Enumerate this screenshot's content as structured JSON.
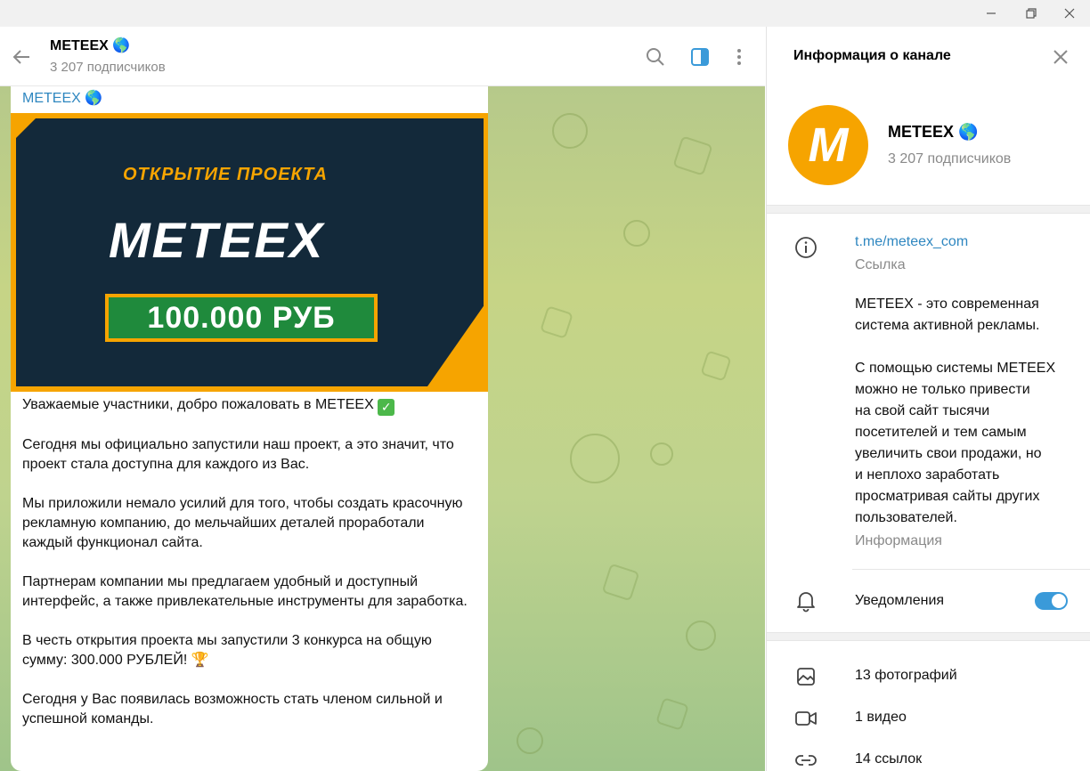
{
  "window": {
    "controls": [
      "minimize-icon",
      "restore-icon",
      "close-icon"
    ]
  },
  "chat": {
    "title": "METEEX 🌎",
    "subtitle": "3 207 подписчиков",
    "header_icons": [
      "search-icon",
      "sidebar-toggle-icon",
      "more-vertical-icon"
    ]
  },
  "message": {
    "author": "METEEX 🌎",
    "banner": {
      "kicker": "ОТКРЫТИЕ ПРОЕКТА",
      "title": "METEEX",
      "prize": "100.000 РУБ"
    },
    "paragraphs": [
      "Уважаемые участники, добро пожаловать в METEEX",
      "Сегодня мы официально запустили наш проект, а это значит, что проект стала доступна для каждого из Вас.",
      "Мы приложили немало усилий для того, чтобы создать красочную рекламную компанию, до мельчайших деталей проработали каждый функционал сайта.",
      "Партнерам компании мы предлагаем удобный и доступный интерфейс, а также привлекательные инструменты для заработка.",
      "В честь открытия проекта мы запустили 3 конкурса на общую сумму: 300.000 РУБЛЕЙ! 🏆",
      "Сегодня у Вас появилась возможность стать членом сильной и успешной команды."
    ],
    "check_emoji": "✓"
  },
  "info_panel": {
    "header_title": "Информация о канале",
    "avatar_letter": "M",
    "name": "METEEX 🌎",
    "subscribers": "3 207 подписчиков",
    "link": "t.me/meteex_com",
    "link_label": "Ссылка",
    "description": "METEEX - это современная\nсистема активной рекламы.\n\nС помощью системы METEEX\nможно не только привести\nна свой сайт тысячи\nпосетителей и тем самым\nувеличить свои продажи, но\nи неплохо заработать\nпросматривая сайты других\nпользователей.",
    "description_label": "Информация",
    "notifications_label": "Уведомления",
    "notifications_on": true,
    "media": [
      {
        "label": "13 фотографий",
        "icon": "photo-icon"
      },
      {
        "label": "1 видео",
        "icon": "video-icon"
      },
      {
        "label": "14 ссылок",
        "icon": "link-icon"
      }
    ]
  },
  "colors": {
    "accent": "#3a9ad9",
    "link": "#2f87c0",
    "brand_orange": "#f6a400",
    "banner_dark": "#13293a",
    "prize_green": "#1f8a3c"
  }
}
